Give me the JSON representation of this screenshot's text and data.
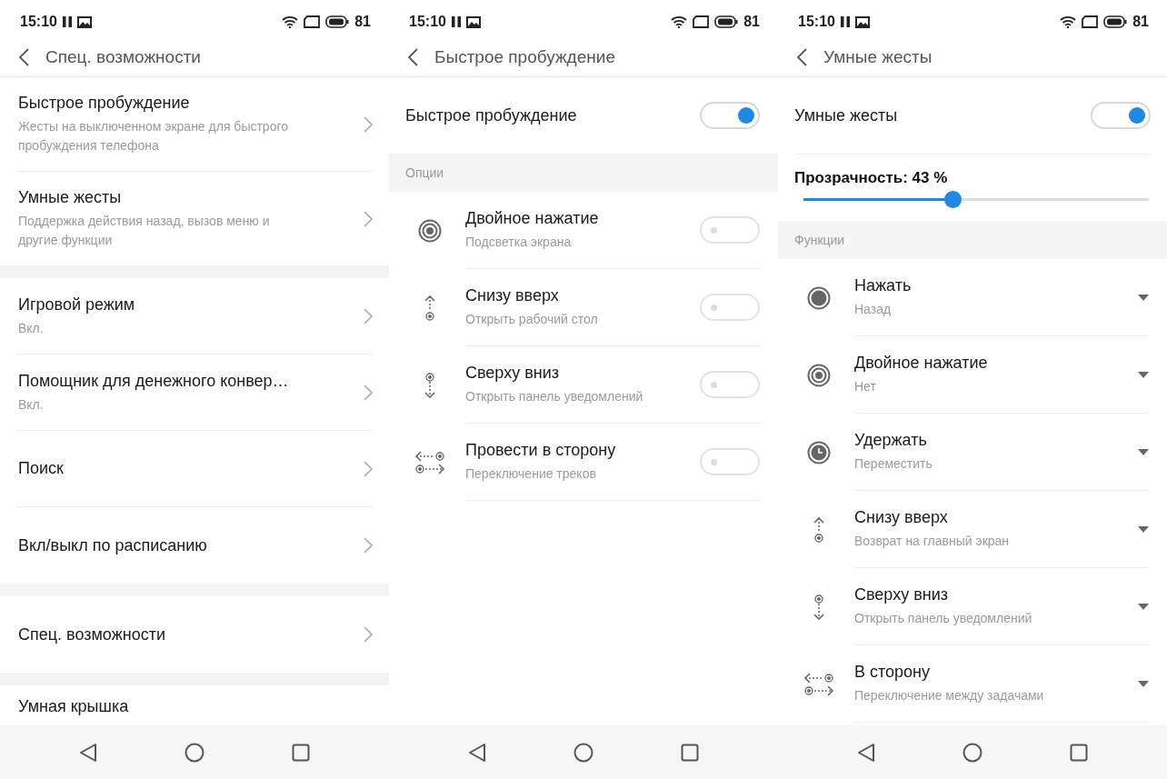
{
  "screens": [
    {
      "status_bar": {
        "time": "15:10",
        "battery": "81"
      },
      "header": {
        "title": "Спец. возможности"
      },
      "sections": [
        {
          "kind": "group",
          "items": [
            {
              "kind": "link",
              "title": "Быстрое пробуждение",
              "subtitle": "Жесты на выключенном экране для быстрого пробуждения телефона"
            },
            {
              "kind": "link",
              "title": "Умные жесты",
              "subtitle": "Поддержка действия назад, вызов меню и другие функции"
            }
          ]
        },
        {
          "kind": "group",
          "items": [
            {
              "kind": "link",
              "title": "Игровой режим",
              "subtitle": "Вкл."
            },
            {
              "kind": "link",
              "title": "Помощник для денежного конвер…",
              "subtitle": "Вкл."
            },
            {
              "kind": "link",
              "title": "Поиск"
            },
            {
              "kind": "link",
              "title": "Вкл/выкл по расписанию"
            }
          ]
        },
        {
          "kind": "group",
          "items": [
            {
              "kind": "link",
              "title": "Спец. возможности"
            }
          ]
        },
        {
          "kind": "group",
          "items": [
            {
              "kind": "plain",
              "title": "Умная крышка"
            }
          ]
        }
      ]
    },
    {
      "status_bar": {
        "time": "15:10",
        "battery": "81"
      },
      "header": {
        "title": "Быстрое пробуждение"
      },
      "sections": [
        {
          "kind": "master_switch",
          "title": "Быстрое пробуждение",
          "on": true,
          "inset": false
        },
        {
          "kind": "section_title",
          "title": "Опции"
        },
        {
          "kind": "switch_gestures",
          "items": [
            {
              "kind": "double_tap",
              "title": "Двойное нажатие",
              "subtitle": "Подсветка экрана",
              "on": false
            },
            {
              "kind": "swipe_up",
              "title": "Снизу вверх",
              "subtitle": "Открыть рабочий стол",
              "on": false
            },
            {
              "kind": "swipe_down",
              "title": "Сверху вниз",
              "subtitle": "Открыть панель уведомлений",
              "on": false
            },
            {
              "kind": "swipe_side",
              "title": "Провести в сторону",
              "subtitle": "Переключение треков",
              "on": false
            }
          ]
        }
      ]
    },
    {
      "status_bar": {
        "time": "15:10",
        "battery": "81"
      },
      "header": {
        "title": "Умные жесты"
      },
      "sections": [
        {
          "kind": "master_switch",
          "title": "Умные жесты",
          "on": true,
          "inset": true
        },
        {
          "kind": "slider",
          "label": "Прозрачность: 43 %",
          "level": 0.43
        },
        {
          "kind": "section_title",
          "title": "Функции"
        },
        {
          "kind": "dropdown_gestures",
          "items": [
            {
              "kind": "tap",
              "title": "Нажать",
              "subtitle": "Назад"
            },
            {
              "kind": "double_tap",
              "title": "Двойное нажатие",
              "subtitle": "Нет"
            },
            {
              "kind": "hold",
              "title": "Удержать",
              "subtitle": "Переместить"
            },
            {
              "kind": "swipe_up",
              "title": "Снизу вверх",
              "subtitle": "Возврат на главный экран"
            },
            {
              "kind": "swipe_down",
              "title": "Сверху вниз",
              "subtitle": "Открыть панель уведомлений"
            },
            {
              "kind": "swipe_side",
              "title": "В сторону",
              "subtitle": "Переключение между задачами"
            }
          ]
        }
      ]
    }
  ]
}
